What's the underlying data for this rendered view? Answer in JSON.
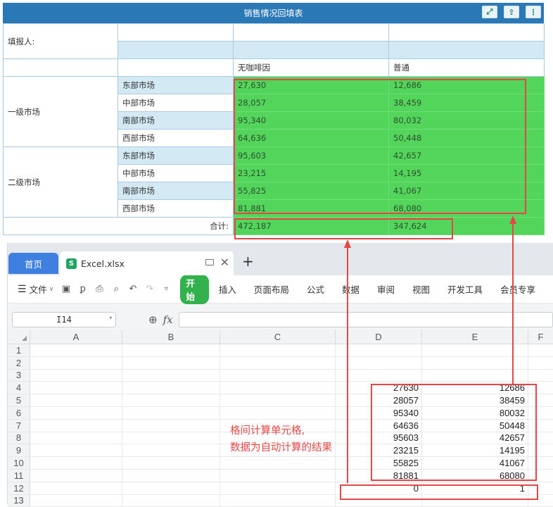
{
  "report": {
    "title": "销售情况回填表",
    "reporter_label": "填报人:",
    "headers": [
      "无咖啡因",
      "普通"
    ],
    "groups": [
      {
        "name": "一级市场",
        "rows": [
          {
            "market": "东部市场",
            "v1": "27,630",
            "v2": "12,686"
          },
          {
            "market": "中部市场",
            "v1": "28,057",
            "v2": "38,459"
          },
          {
            "market": "南部市场",
            "v1": "95,340",
            "v2": "80,032"
          },
          {
            "market": "西部市场",
            "v1": "64,636",
            "v2": "50,448"
          }
        ]
      },
      {
        "name": "二级市场",
        "rows": [
          {
            "market": "东部市场",
            "v1": "95,603",
            "v2": "42,657"
          },
          {
            "market": "中部市场",
            "v1": "23,215",
            "v2": "14,195"
          },
          {
            "market": "南部市场",
            "v1": "55,825",
            "v2": "41,067"
          },
          {
            "market": "西部市场",
            "v1": "81,881",
            "v2": "68,080"
          }
        ]
      }
    ],
    "total_label": "合计:",
    "totals": [
      "472,187",
      "347,624"
    ]
  },
  "excel": {
    "tabs": {
      "home": "首页",
      "file": "Excel.xlsx",
      "add": "+"
    },
    "menu": {
      "file": "文件",
      "start": "开始",
      "items": [
        "插入",
        "页面布局",
        "公式",
        "数据",
        "审阅",
        "视图",
        "开发工具",
        "会员专享"
      ]
    },
    "namebox": "I14",
    "fx": "fx",
    "columns": [
      "A",
      "B",
      "C",
      "D",
      "E",
      "F"
    ],
    "rows": [
      {
        "n": "1",
        "d": "",
        "e": ""
      },
      {
        "n": "2",
        "d": "",
        "e": ""
      },
      {
        "n": "3",
        "d": "",
        "e": ""
      },
      {
        "n": "4",
        "d": "27630",
        "e": "12686"
      },
      {
        "n": "5",
        "d": "28057",
        "e": "38459"
      },
      {
        "n": "6",
        "d": "95340",
        "e": "80032"
      },
      {
        "n": "7",
        "d": "64636",
        "e": "50448"
      },
      {
        "n": "8",
        "d": "95603",
        "e": "42657"
      },
      {
        "n": "9",
        "d": "23215",
        "e": "14195"
      },
      {
        "n": "10",
        "d": "55825",
        "e": "41067"
      },
      {
        "n": "11",
        "d": "81881",
        "e": "68080"
      },
      {
        "n": "12",
        "d": "0",
        "e": "1"
      },
      {
        "n": "13",
        "d": "",
        "e": ""
      }
    ]
  },
  "annotation": {
    "line1": "格间计算单元格,",
    "line2": "数据为自动计算的结果"
  },
  "colors": {
    "accent": "#2a78b6",
    "fill_green": "#53d45a",
    "annotation_red": "#e84545",
    "excel_green": "#33b14d"
  }
}
